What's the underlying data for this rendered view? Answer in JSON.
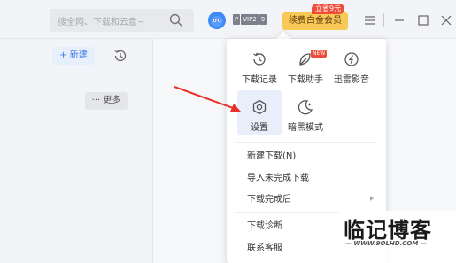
{
  "titlebar": {
    "search_placeholder": "搜全网、下载和云盘~",
    "vip_badges": [
      "P",
      "VIP2",
      "9"
    ],
    "renew_button": "续费白金会员",
    "promo_tag": "立省9元",
    "menu_icon": "hamburger-icon",
    "minimize_icon": "minimize-icon",
    "maximize_icon": "maximize-icon",
    "close_icon": "close-icon"
  },
  "toolbar": {
    "new_button": "+ 新建",
    "history_icon": "history-icon"
  },
  "list": {
    "more_button": "··· 更多"
  },
  "menu": {
    "tools": [
      {
        "label": "下载记录",
        "icon": "download-record-icon"
      },
      {
        "label": "下载助手",
        "icon": "download-assistant-icon",
        "tag": "NEW"
      },
      {
        "label": "迅雷影音",
        "icon": "xunlei-player-icon"
      },
      {
        "label": "设置",
        "icon": "settings-gear-icon",
        "active": true
      },
      {
        "label": "暗黑模式",
        "icon": "dark-mode-moon-icon"
      }
    ],
    "items": [
      {
        "label": "新建下载(N)"
      },
      {
        "label": "导入未完成下载"
      },
      {
        "label": "下载完成后",
        "has_submenu": true
      },
      {
        "label": "下载诊断"
      },
      {
        "label": "联系客服"
      }
    ]
  },
  "annotation": {
    "color": "#e8332a"
  },
  "watermark": {
    "title": "临记博客",
    "url": "— WWW.9OLHD.COM —"
  }
}
